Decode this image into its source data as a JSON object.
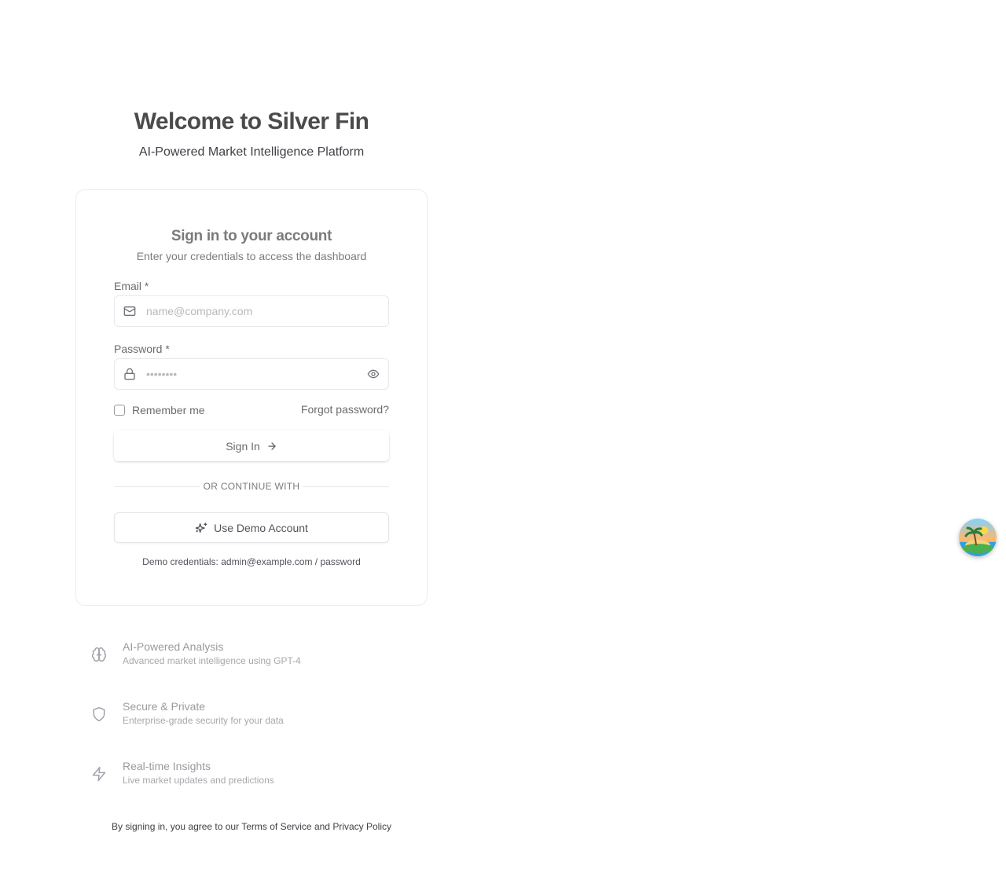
{
  "header": {
    "title": "Welcome to Silver Fin",
    "subtitle": "AI-Powered Market Intelligence Platform"
  },
  "login": {
    "title": "Sign in to your account",
    "description": "Enter your credentials to access the dashboard",
    "email_label": "Email *",
    "email_placeholder": "name@company.com",
    "email_value": "",
    "email_icon": "mail-icon",
    "password_label": "Password *",
    "password_placeholder": "••••••••",
    "password_value": "",
    "password_icon": "lock-icon",
    "show_password_icon": "eye-icon",
    "remember_label": "Remember me",
    "remember_checked": false,
    "forgot_label": "Forgot password?",
    "signin_label": "Sign In",
    "signin_icon": "arrow-right-icon",
    "divider_text": "OR CONTINUE WITH",
    "demo_label": "Use Demo Account",
    "demo_icon": "sparkles-icon",
    "demo_credentials": "Demo credentials: admin@example.com / password"
  },
  "features": [
    {
      "icon": "brain-icon",
      "title": "AI-Powered Analysis",
      "description": "Advanced market intelligence using GPT-4"
    },
    {
      "icon": "shield-icon",
      "title": "Secure & Private",
      "description": "Enterprise-grade security for your data"
    },
    {
      "icon": "zap-icon",
      "title": "Real-time Insights",
      "description": "Live market updates and predictions"
    }
  ],
  "footer": {
    "prefix": "By signing in, you agree to our",
    "terms_link": "Terms of Service",
    "conjunction": "and",
    "privacy_link": "Privacy Policy"
  },
  "floating_avatar": {
    "icon": "island-avatar-icon"
  }
}
